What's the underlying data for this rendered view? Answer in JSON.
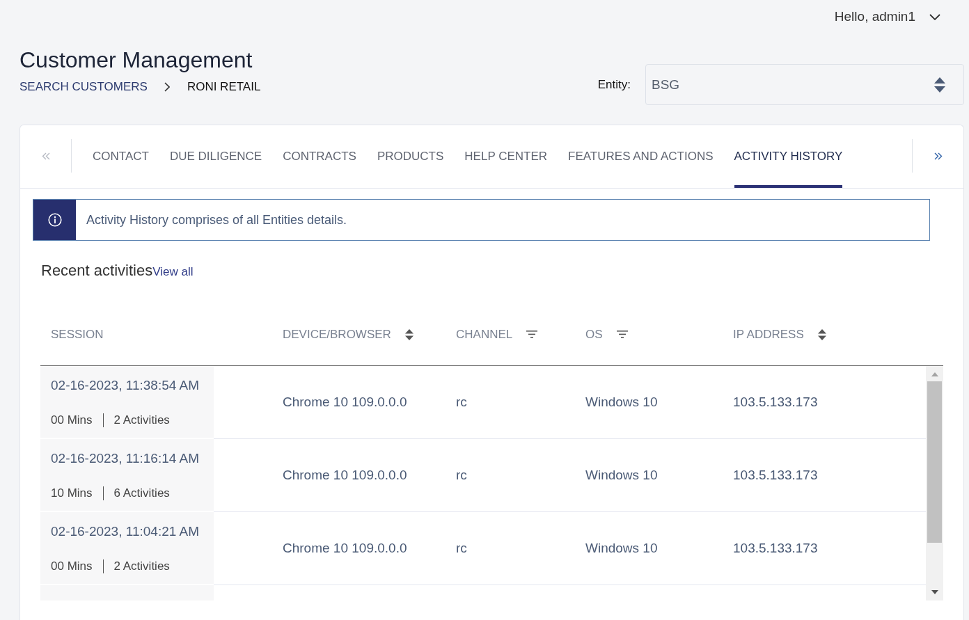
{
  "user_menu": {
    "greeting": "Hello, admin1"
  },
  "page": {
    "title": "Customer Management",
    "breadcrumb": [
      {
        "label": "SEARCH CUSTOMERS",
        "kind": "link"
      },
      {
        "label": "RONI RETAIL",
        "kind": "current"
      }
    ]
  },
  "entity": {
    "label": "Entity:",
    "value": "BSG"
  },
  "tab_nav": {
    "prev": {
      "disabled": true
    },
    "next": {
      "disabled": false
    }
  },
  "tabs": [
    {
      "label": "CONTACT",
      "selected": false
    },
    {
      "label": "DUE DILIGENCE",
      "selected": false
    },
    {
      "label": "CONTRACTS",
      "selected": false
    },
    {
      "label": "PRODUCTS",
      "selected": false
    },
    {
      "label": "HELP CENTER",
      "selected": false
    },
    {
      "label": "FEATURES AND ACTIONS",
      "selected": false
    },
    {
      "label": "ACTIVITY HISTORY",
      "selected": true
    }
  ],
  "info_banner": {
    "text": "Activity History comprises of all Entities details."
  },
  "recent": {
    "title": "Recent activities",
    "link": "View all"
  },
  "table": {
    "columns": [
      {
        "label": "SESSION",
        "kind": "plain"
      },
      {
        "label": "DEVICE/BROWSER",
        "kind": "sortable"
      },
      {
        "label": "CHANNEL",
        "kind": "filterable"
      },
      {
        "label": "OS",
        "kind": "filterable"
      },
      {
        "label": "IP ADDRESS",
        "kind": "sortable"
      }
    ],
    "rows": [
      {
        "date": "02-16-2023, 11:38:54 AM",
        "duration": "00 Mins",
        "activities": "2 Activities",
        "device": "Chrome 10 109.0.0.0",
        "channel": "rc",
        "os": "Windows 10",
        "ip": "103.5.133.173"
      },
      {
        "date": "02-16-2023, 11:16:14 AM",
        "duration": "10 Mins",
        "activities": "6 Activities",
        "device": "Chrome 10 109.0.0.0",
        "channel": "rc",
        "os": "Windows 10",
        "ip": "103.5.133.173"
      },
      {
        "date": "02-16-2023, 11:04:21 AM",
        "duration": "00 Mins",
        "activities": "2 Activities",
        "device": "Chrome 10 109.0.0.0",
        "channel": "rc",
        "os": "Windows 10",
        "ip": "103.5.133.173"
      }
    ]
  }
}
